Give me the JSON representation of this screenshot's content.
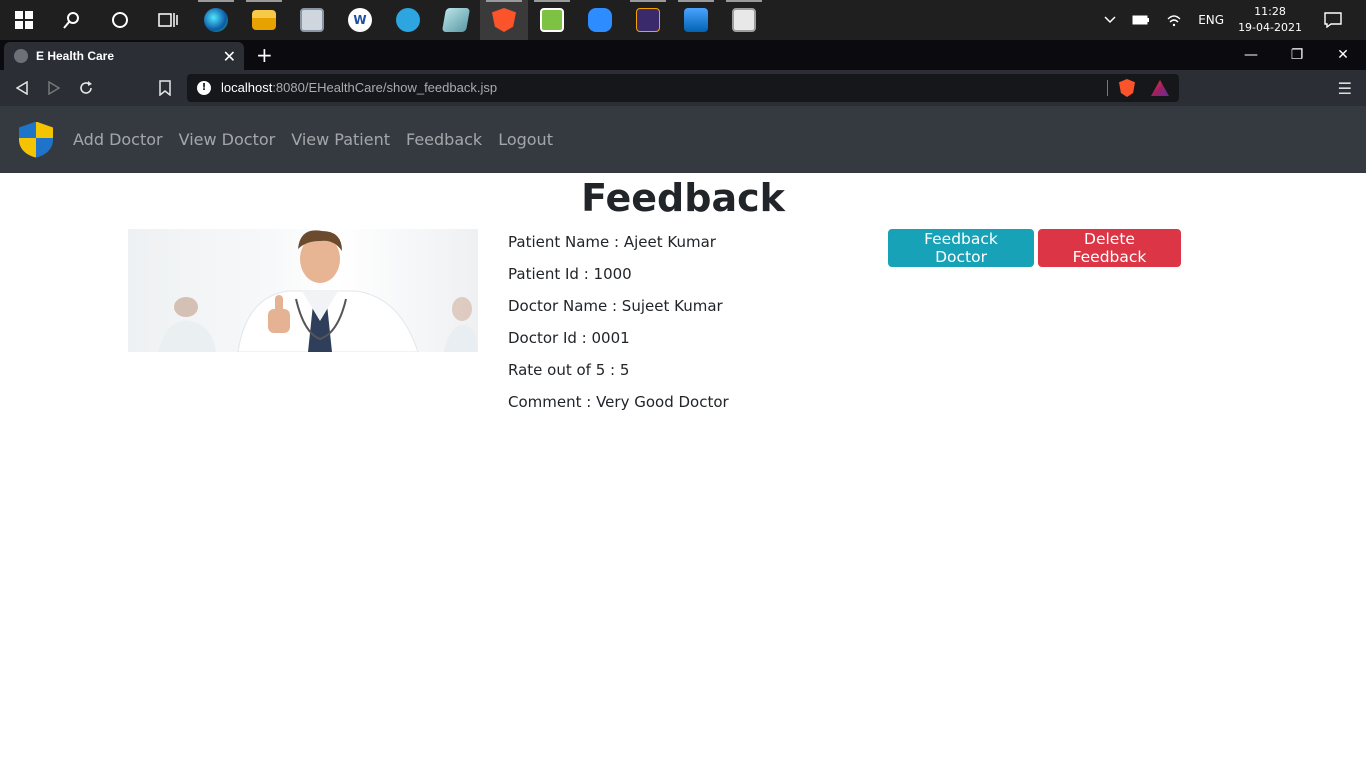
{
  "taskbar": {
    "apps": [
      "windows-start",
      "search",
      "cortana",
      "task-view",
      "edge",
      "file-explorer",
      "app-monitor",
      "word-like",
      "telegram",
      "notepad-like",
      "brave",
      "notepad-plus",
      "zoom",
      "game",
      "photos",
      "news"
    ],
    "tray": {
      "language": "ENG",
      "time": "11:28",
      "date": "19-04-2021"
    }
  },
  "browser": {
    "tab_title": "E Health Care",
    "url_host": "localhost",
    "url_path": ":8080/EHealthCare/show_feedback.jsp"
  },
  "navbar": {
    "links": [
      "Add Doctor",
      "View Doctor",
      "View Patient",
      "Feedback",
      "Logout"
    ]
  },
  "page": {
    "title": "Feedback",
    "details": [
      "Patient Name : Ajeet Kumar",
      "Patient Id : 1000",
      "Doctor Name : Sujeet Kumar",
      "Doctor Id : 0001",
      "Rate out of 5 : 5",
      "Comment : Very Good Doctor"
    ],
    "buttons": {
      "feedback_doctor": "Feedback Doctor",
      "delete_feedback": "Delete Feedback"
    }
  },
  "colors": {
    "navbar_bg": "#343a40",
    "btn_info": "#17a2b8",
    "btn_danger": "#dc3545"
  }
}
